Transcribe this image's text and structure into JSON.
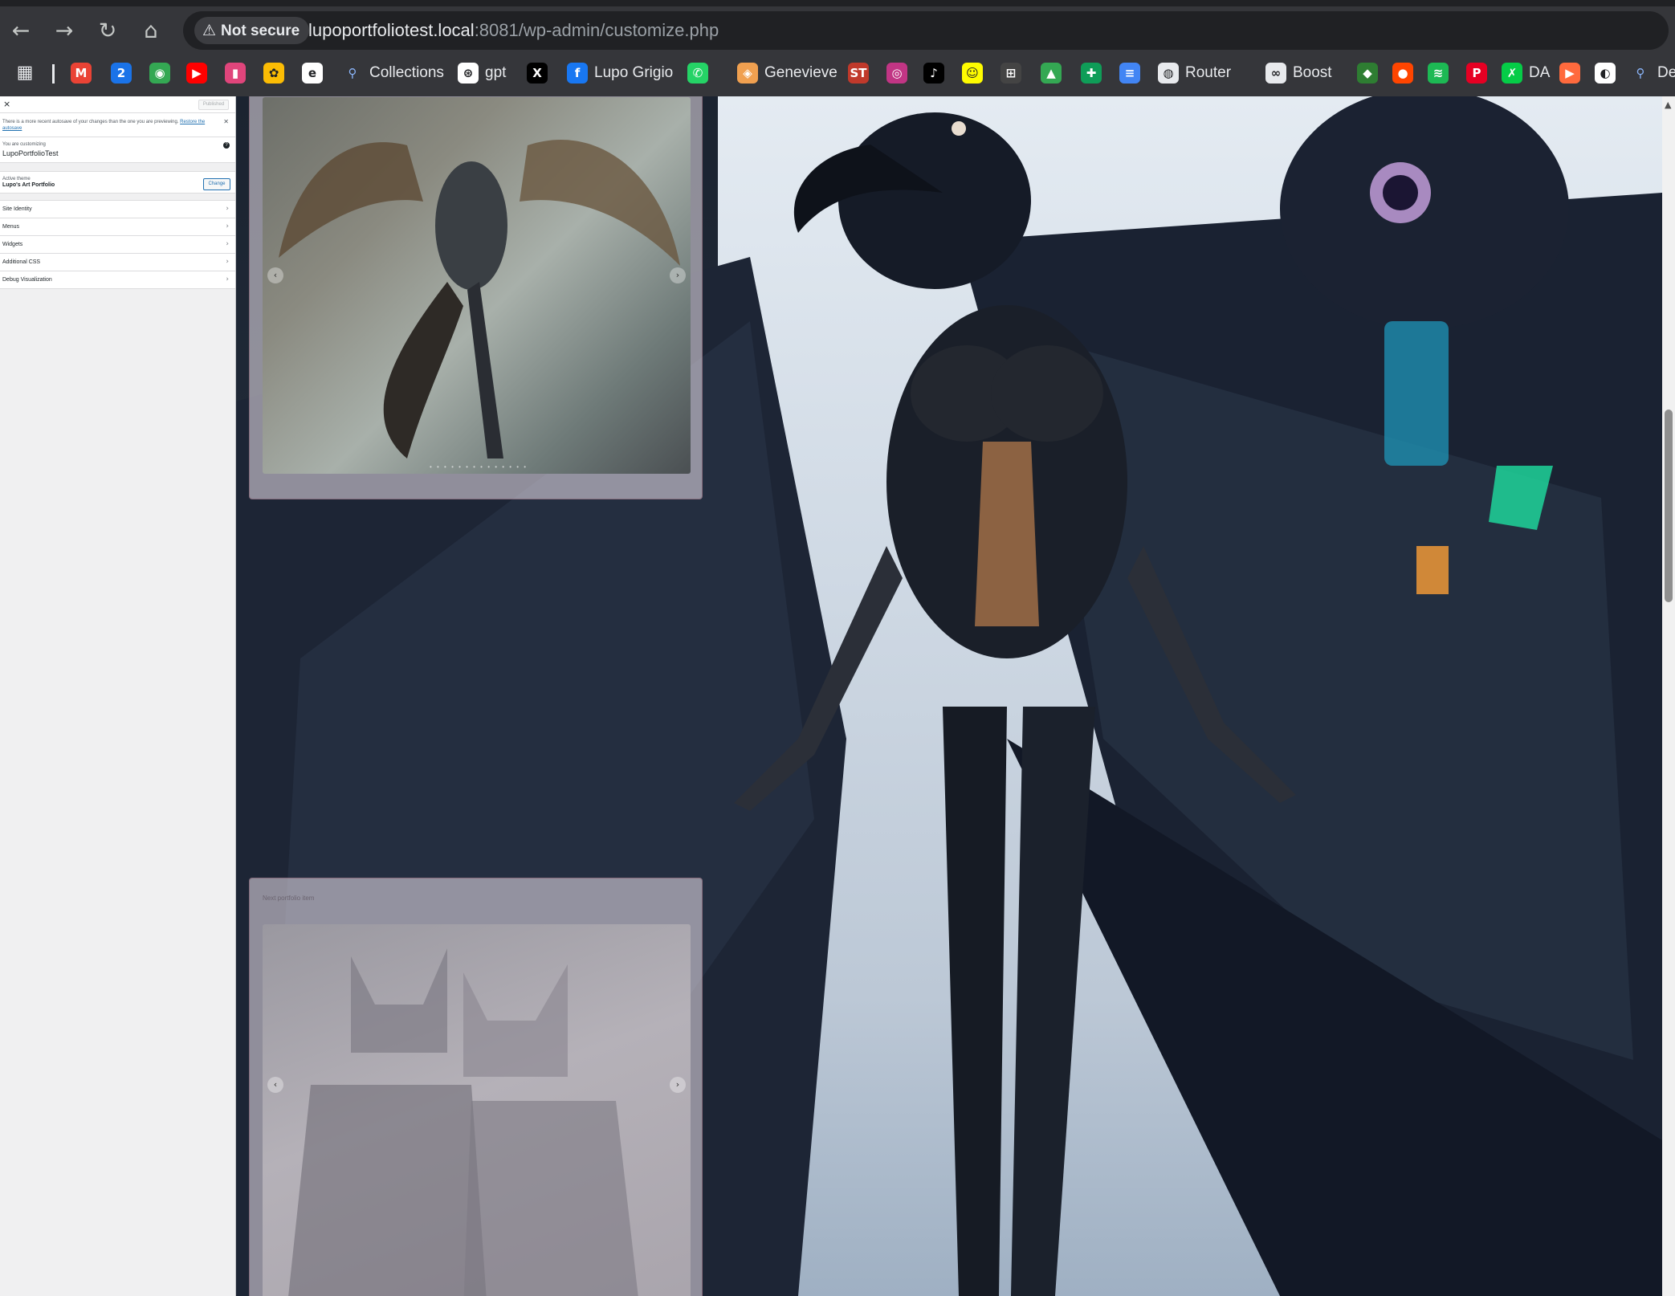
{
  "browser": {
    "security_label": "Not secure",
    "url_host": "lupoportfoliotest.local",
    "url_rest": ":8081/wp-admin/customize.php"
  },
  "bookmarks": [
    {
      "label": "",
      "icon": "apps-grid-icon"
    },
    {
      "label": "",
      "icon": "gmail-icon",
      "color": "#ea4335"
    },
    {
      "label": "",
      "icon": "calendar-icon",
      "color": "#1a73e8"
    },
    {
      "label": "",
      "icon": "maps-icon",
      "color": "#34a853"
    },
    {
      "label": "",
      "icon": "youtube-icon",
      "color": "#ff0000"
    },
    {
      "label": "",
      "icon": "app-icon",
      "color": "#e0457b"
    },
    {
      "label": "",
      "icon": "photos-icon",
      "color": "#fbbc04"
    },
    {
      "label": "",
      "icon": "edge-icon",
      "color": "#ffffff"
    },
    {
      "label": "Collections",
      "icon": "search-icon",
      "color": "#8ab4f8"
    },
    {
      "label": "gpt",
      "icon": "openai-icon",
      "color": "#ffffff"
    },
    {
      "label": "",
      "icon": "x-icon",
      "color": "#000000"
    },
    {
      "label": "Lupo Grigio",
      "icon": "facebook-icon",
      "color": "#1877f2"
    },
    {
      "label": "",
      "icon": "whatsapp-icon",
      "color": "#25d366"
    },
    {
      "label": "Genevieve",
      "icon": "stack-icon",
      "color": "#f0a050"
    },
    {
      "label": "",
      "icon": "st-icon",
      "color": "#c0392b"
    },
    {
      "label": "",
      "icon": "instagram-icon",
      "color": "#c13584"
    },
    {
      "label": "",
      "icon": "tiktok-icon",
      "color": "#000000"
    },
    {
      "label": "",
      "icon": "snapchat-icon",
      "color": "#fffc00"
    },
    {
      "label": "",
      "icon": "ai-icon",
      "color": "#444444"
    },
    {
      "label": "",
      "icon": "drive-icon",
      "color": "#34a853"
    },
    {
      "label": "",
      "icon": "sheets-icon",
      "color": "#0f9d58"
    },
    {
      "label": "",
      "icon": "docs-icon",
      "color": "#4285f4"
    },
    {
      "label": "Router",
      "icon": "globe-icon",
      "color": "#e8eaed"
    },
    {
      "label": "Boost",
      "icon": "boost-icon",
      "color": "#e8eaed"
    },
    {
      "label": "",
      "icon": "map-icon",
      "color": "#2e7d32"
    },
    {
      "label": "",
      "icon": "reddit-icon",
      "color": "#ff4500"
    },
    {
      "label": "",
      "icon": "spotify-icon",
      "color": "#1db954"
    },
    {
      "label": "",
      "icon": "pinterest-icon",
      "color": "#e60023"
    },
    {
      "label": "DA",
      "icon": "deviantart-icon",
      "color": "#05cc47"
    },
    {
      "label": "",
      "icon": "powerpoint-icon",
      "color": "#ff6a3d"
    },
    {
      "label": "",
      "icon": "github-icon",
      "color": "#ffffff"
    },
    {
      "label": "Des",
      "icon": "search-icon",
      "color": "#8ab4f8"
    }
  ],
  "customizer": {
    "publish_label": "Published",
    "autosave_notice": "There is a more recent autosave of your changes than the one you are previewing.",
    "restore_link": "Restore the autosave",
    "customizing_label": "You are customizing",
    "site_name": "LupoPortfolioTest",
    "active_theme_label": "Active theme",
    "theme_name": "Lupo's Art Portfolio",
    "change_label": "Change",
    "sections": [
      "Site Identity",
      "Menus",
      "Widgets",
      "Additional CSS",
      "Debug Visualization"
    ]
  },
  "preview": {
    "next_label": "Next portfolio item"
  }
}
